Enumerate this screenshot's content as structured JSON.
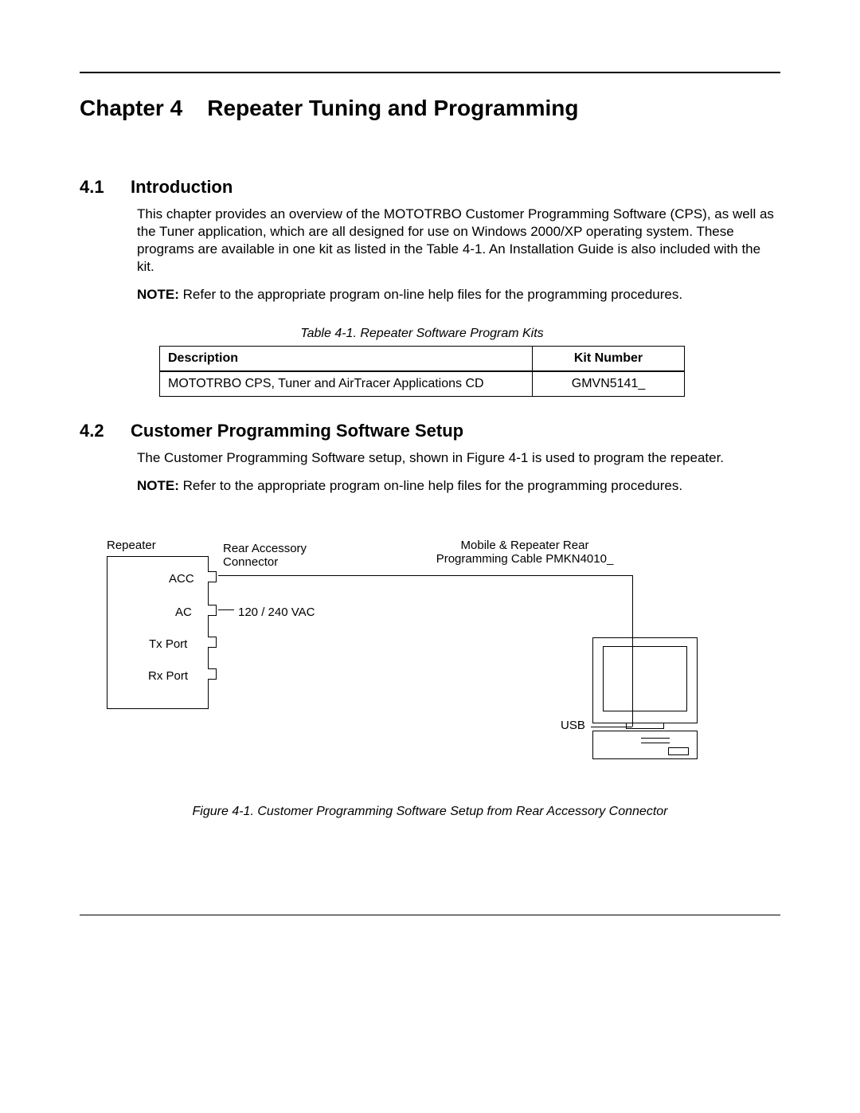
{
  "chapter": {
    "label": "Chapter 4",
    "title": "Repeater Tuning and Programming"
  },
  "section1": {
    "num": "4.1",
    "title": "Introduction",
    "para": "This chapter provides an overview of the MOTOTRBO Customer Programming Software (CPS), as well as the Tuner application, which are all designed for use on Windows 2000/XP operating system. These programs are available in one kit as listed in the Table 4-1. An Installation Guide is also included with the kit.",
    "note_label": "NOTE:",
    "note_text": "Refer to the appropriate program on-line help files for the programming procedures."
  },
  "table": {
    "caption": "Table 4-1.  Repeater Software Program Kits",
    "head_desc": "Description",
    "head_kit": "Kit Number",
    "row_desc": "MOTOTRBO CPS, Tuner and AirTracer Applications CD",
    "row_kit": "GMVN5141_"
  },
  "section2": {
    "num": "4.2",
    "title": "Customer Programming Software Setup",
    "para": "The Customer Programming Software setup, shown in Figure 4-1 is used to program the repeater.",
    "note_label": "NOTE:",
    "note_text": "Refer to the appropriate program on-line help files for the programming procedures."
  },
  "figure": {
    "repeater": "Repeater",
    "acc": "ACC",
    "ac": "AC",
    "txport": "Tx Port",
    "rxport": "Rx Port",
    "rear_acc": "Rear Accessory Connector",
    "voltage": "120 / 240 VAC",
    "cable_top_line1": "Mobile & Repeater Rear",
    "cable_top_line2": "Programming Cable PMKN4010_",
    "usb": "USB",
    "caption": "Figure 4-1.  Customer Programming Software Setup from Rear Accessory Connector"
  }
}
